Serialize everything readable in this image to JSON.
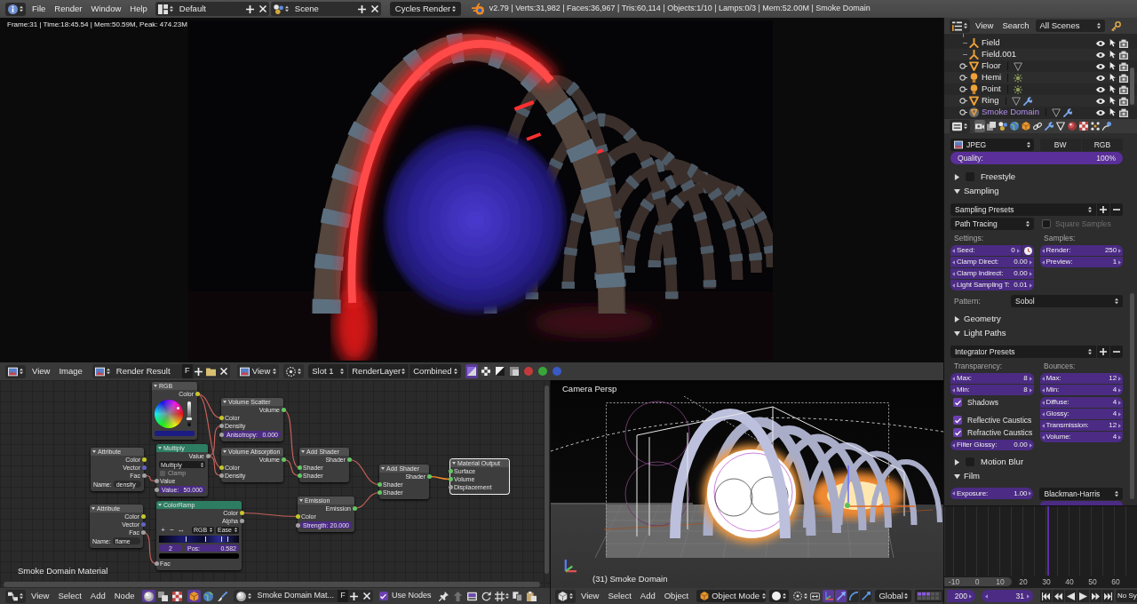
{
  "info_header": {
    "menus": [
      "File",
      "Render",
      "Window",
      "Help"
    ],
    "layout": "Default",
    "scene": "Scene",
    "engine": "Cycles Render",
    "stats": "v2.79 | Verts:31,982 | Faces:36,967 | Tris:60,114 | Objects:1/10 | Lamps:0/3 | Mem:52.00M | Smoke Domain"
  },
  "image_editor": {
    "render_info": "Frame:31 | Time:18:45.54 | Mem:50.59M, Peak: 474.23M",
    "header": {
      "menus": [
        "View",
        "Image"
      ],
      "image": "Render Result",
      "fake_user": "F",
      "view": "View",
      "slot": "Slot 1",
      "layer": "RenderLayer",
      "pass": "Combined",
      "channels": [
        {
          "selected": true
        },
        {
          "selected": false
        },
        {
          "selected": false
        },
        {
          "selected": false
        },
        {
          "selected": false
        },
        {
          "selected": false
        },
        {
          "selected": false
        }
      ]
    }
  },
  "node_editor": {
    "nodes": [
      {
        "title": "RGB",
        "kind": "input",
        "selected": false,
        "rows": [
          {
            "kind": "output",
            "label": "Color",
            "color": "#c7c729"
          },
          {
            "kind": "color_picker",
            "level": 0.3
          },
          {
            "kind": "swatch",
            "color": "#1b1c84"
          }
        ]
      },
      {
        "title": "Volume Scatter",
        "kind": "shader",
        "selected": false,
        "rows": [
          {
            "kind": "output",
            "label": "Volume",
            "color": "#63c763"
          },
          {
            "kind": "input",
            "label": "Color",
            "color": "#c7c729"
          },
          {
            "kind": "input",
            "label": "Density",
            "color": "#a1a1a1"
          },
          {
            "kind": "field",
            "label": "Anisotropy:",
            "value": "0.000",
            "color": "#a1a1a1"
          }
        ]
      },
      {
        "title": "Attribute",
        "kind": "input",
        "selected": false,
        "rows": [
          {
            "kind": "output",
            "label": "Color",
            "color": "#c7c729"
          },
          {
            "kind": "output",
            "label": "Vector",
            "color": "#6363c7"
          },
          {
            "kind": "output",
            "label": "Fac",
            "color": "#a1a1a1"
          },
          {
            "kind": "text",
            "label": "Name:",
            "value": "density"
          }
        ]
      },
      {
        "title": "Multiply",
        "kind": "converter",
        "selected": false,
        "rows": [
          {
            "kind": "output",
            "label": "Value",
            "color": "#a1a1a1"
          },
          {
            "kind": "dropdown",
            "value": "Multiply"
          },
          {
            "kind": "checkbox",
            "label": "Clamp",
            "checked": false
          },
          {
            "kind": "input",
            "label": "Value",
            "color": "#a1a1a1"
          },
          {
            "kind": "field",
            "label": "Value:",
            "value": "50.000",
            "color": "#a1a1a1"
          }
        ]
      },
      {
        "title": "Volume Absorption",
        "kind": "shader",
        "selected": false,
        "rows": [
          {
            "kind": "output",
            "label": "Volume",
            "color": "#63c763"
          },
          {
            "kind": "input",
            "label": "Color",
            "color": "#c7c729"
          },
          {
            "kind": "input",
            "label": "Density",
            "color": "#a1a1a1"
          }
        ]
      },
      {
        "title": "Add Shader",
        "kind": "shader",
        "selected": false,
        "rows": [
          {
            "kind": "output",
            "label": "Shader",
            "color": "#63c763"
          },
          {
            "kind": "input",
            "label": "Shader",
            "color": "#63c763"
          },
          {
            "kind": "input",
            "label": "Shader",
            "color": "#63c763"
          }
        ]
      },
      {
        "title": "Add Shader",
        "kind": "shader",
        "selected": false,
        "rows": [
          {
            "kind": "output",
            "label": "Shader",
            "color": "#63c763"
          },
          {
            "kind": "input",
            "label": "Shader",
            "color": "#63c763"
          },
          {
            "kind": "input",
            "label": "Shader",
            "color": "#63c763"
          }
        ]
      },
      {
        "title": "Material Output",
        "kind": "output",
        "selected": true,
        "rows": [
          {
            "kind": "input",
            "label": "Surface",
            "color": "#63c763"
          },
          {
            "kind": "input",
            "label": "Volume",
            "color": "#63c763"
          },
          {
            "kind": "input",
            "label": "Displacement",
            "color": "#a1a1a1"
          }
        ]
      },
      {
        "title": "Attribute",
        "kind": "input",
        "selected": false,
        "rows": [
          {
            "kind": "output",
            "label": "Color",
            "color": "#c7c729"
          },
          {
            "kind": "output",
            "label": "Vector",
            "color": "#6363c7"
          },
          {
            "kind": "output",
            "label": "Fac",
            "color": "#a1a1a1"
          },
          {
            "kind": "text",
            "label": "Name:",
            "value": "flame"
          }
        ]
      },
      {
        "title": "ColorRamp",
        "kind": "converter",
        "selected": false,
        "rows": [
          {
            "kind": "output",
            "label": "Color",
            "color": "#c7c729"
          },
          {
            "kind": "output",
            "label": "Alpha",
            "color": "#a1a1a1"
          },
          {
            "kind": "ramp_tools",
            "buttons": [
              "+",
              "−",
              "↔"
            ],
            "mode": "RGB",
            "interpolation": "Ease"
          },
          {
            "kind": "ramp"
          },
          {
            "kind": "stop",
            "stop": "2",
            "label": "Pos:",
            "value": "0.582"
          },
          {
            "kind": "swatch",
            "color": "#000000"
          },
          {
            "kind": "input",
            "label": "Fac",
            "color": "#a1a1a1"
          }
        ]
      },
      {
        "title": "Emission",
        "kind": "shader",
        "selected": false,
        "rows": [
          {
            "kind": "output",
            "label": "Emission",
            "color": "#63c763"
          },
          {
            "kind": "input",
            "label": "Color",
            "color": "#c7c729"
          },
          {
            "kind": "field",
            "label": "Strength:",
            "value": "20.000",
            "color": "#a1a1a1"
          }
        ]
      }
    ],
    "material_label": "Smoke Domain Material",
    "header": {
      "menus": [
        "View",
        "Select",
        "Add",
        "Node"
      ],
      "tree_types": [
        {
          "selected": true
        },
        {
          "selected": false
        },
        {
          "selected": false
        }
      ],
      "shader_types": [
        {
          "selected": true
        },
        {
          "selected": false
        },
        {
          "selected": false
        }
      ],
      "material": "Smoke Domain Mat...",
      "fake_user": "F",
      "use_nodes": {
        "label": "Use Nodes",
        "checked": true
      }
    }
  },
  "viewport": {
    "view_name": "Camera Persp",
    "object_info": "(31) Smoke Domain",
    "header": {
      "menus": [
        "View",
        "Select",
        "Add",
        "Object"
      ],
      "mode": "Object Mode",
      "manipulators": [
        {
          "selected": true
        },
        {
          "selected": true
        },
        {
          "selected": false
        },
        {
          "selected": false
        }
      ],
      "orientation": "Global"
    }
  },
  "outliner": {
    "header": {
      "menus": [
        "View",
        "Search"
      ],
      "filter": "All Scenes"
    },
    "items": [
      {
        "name": "Field",
        "kind": "field",
        "expandable": false,
        "active": false
      },
      {
        "name": "Field.001",
        "kind": "field",
        "expandable": false,
        "active": false
      },
      {
        "name": "Floor",
        "kind": "mesh",
        "expandable": true,
        "active": false,
        "data": [
          {
            "kind": "mesh"
          }
        ]
      },
      {
        "name": "Hemi",
        "kind": "lamp",
        "expandable": true,
        "active": false,
        "data": [
          {
            "kind": "lamp"
          }
        ]
      },
      {
        "name": "Point",
        "kind": "lamp",
        "expandable": true,
        "active": false,
        "data": [
          {
            "kind": "lamp"
          }
        ]
      },
      {
        "name": "Ring",
        "kind": "mesh",
        "expandable": true,
        "active": false,
        "data": [
          {
            "kind": "mesh"
          },
          {
            "kind": "modifier"
          }
        ]
      },
      {
        "name": "Smoke Domain",
        "kind": "mesh",
        "expandable": true,
        "active": true,
        "data": [
          {
            "kind": "mesh"
          },
          {
            "kind": "modifier"
          }
        ]
      }
    ]
  },
  "properties": {
    "tabs": [
      {
        "selected": true
      },
      {
        "selected": false
      },
      {
        "selected": false
      },
      {
        "selected": false
      },
      {
        "selected": false
      },
      {
        "selected": false
      },
      {
        "selected": false
      },
      {
        "selected": false
      },
      {
        "selected": false
      },
      {
        "selected": false
      },
      {
        "selected": false
      },
      {
        "selected": false
      }
    ],
    "output": {
      "format": "JPEG",
      "color_modes": [
        "BW",
        "RGB"
      ],
      "quality": {
        "label": "Quality:",
        "value": "100%",
        "level": 1
      }
    },
    "panels": [
      {
        "title": "Freestyle",
        "expanded": false,
        "checked": false
      },
      {
        "kind": "sampling",
        "title": "Sampling",
        "expanded": true,
        "presets": "Sampling Presets",
        "integrator": "Path Tracing",
        "square_samples": {
          "label": "Square Samples",
          "checked": false,
          "disabled": true
        },
        "settings_label": "Settings:",
        "settings": [
          {
            "label": "Seed:",
            "value": "0"
          },
          {
            "label": "Clamp Direct:",
            "value": "0.00"
          },
          {
            "label": "Clamp Indirect:",
            "value": "0.00"
          },
          {
            "label": "Light Sampling T:",
            "value": "0.01"
          }
        ],
        "samples_label": "Samples:",
        "samples": [
          {
            "label": "Render:",
            "value": "250"
          },
          {
            "label": "Preview:",
            "value": "1"
          }
        ],
        "pattern_label": "Pattern:",
        "pattern": "Sobol"
      },
      {
        "title": "Geometry",
        "expanded": false
      },
      {
        "kind": "light_paths",
        "title": "Light Paths",
        "expanded": true,
        "presets": "Integrator Presets",
        "transparency_label": "Transparency:",
        "transparency": [
          {
            "label": "Max:",
            "value": "8"
          },
          {
            "label": "Min:",
            "value": "8"
          }
        ],
        "options": [
          {
            "label": "Shadows",
            "checked": true
          },
          {
            "label": "Reflective Caustics",
            "checked": true
          },
          {
            "label": "Refractive Caustics",
            "checked": true
          }
        ],
        "filter_glossy": {
          "label": "Filter Glossy:",
          "value": "0.00"
        },
        "bounces_label": "Bounces:",
        "bounces": [
          {
            "label": "Max:",
            "value": "12"
          },
          {
            "label": "Min:",
            "value": "4"
          },
          {
            "label": "Diffuse:",
            "value": "4"
          },
          {
            "label": "Glossy:",
            "value": "4"
          },
          {
            "label": "Transmission:",
            "value": "12"
          },
          {
            "label": "Volume:",
            "value": "4"
          }
        ]
      },
      {
        "title": "Motion Blur",
        "expanded": false,
        "checked": false
      },
      {
        "kind": "film",
        "title": "Film",
        "expanded": true,
        "exposure": {
          "label": "Exposure:",
          "value": "1.00"
        },
        "filter": "Blackman-Harris"
      }
    ]
  },
  "timeline": {
    "ruler": [
      "-10",
      "0",
      "10",
      "20",
      "30",
      "40",
      "50",
      "60"
    ],
    "end_frame": "200",
    "current_frame": "31",
    "sync": "No Sy"
  }
}
